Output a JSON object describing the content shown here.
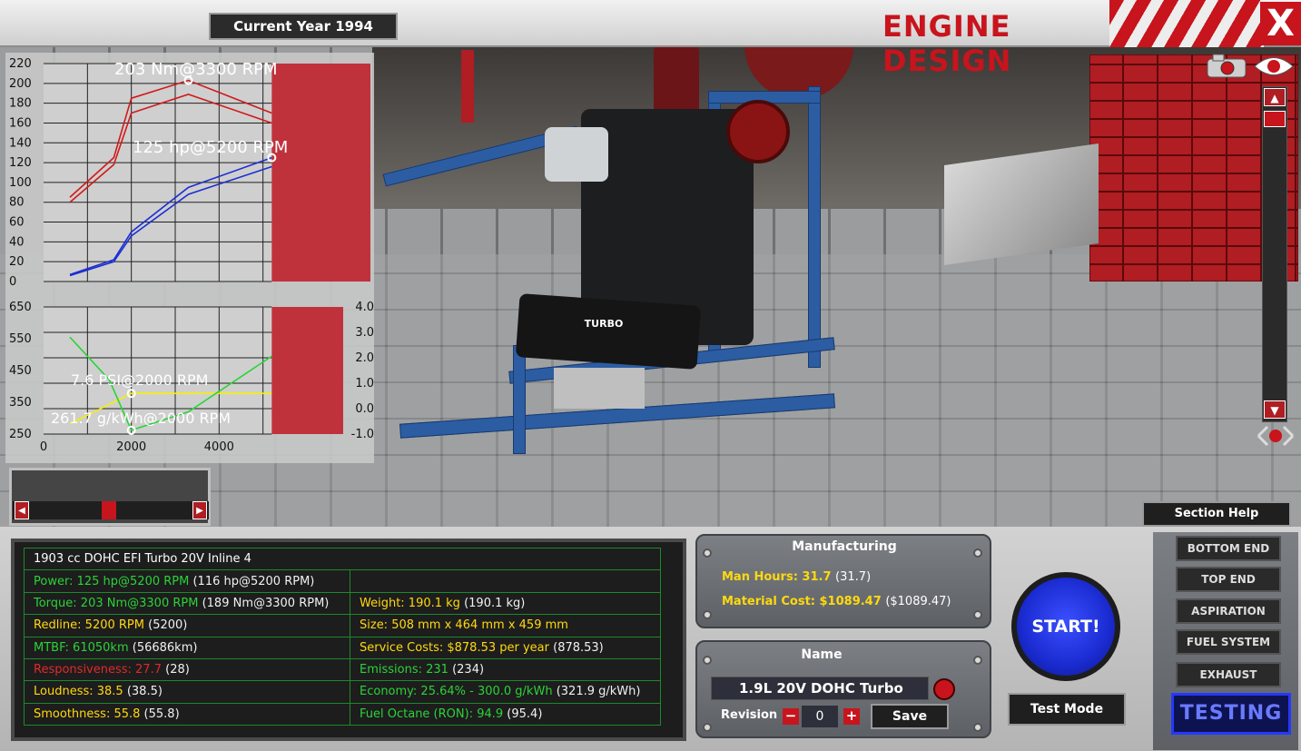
{
  "header": {
    "current_year_label": "Current Year 1994",
    "title": "ENGINE DESIGN",
    "close_label": "X"
  },
  "colors": {
    "accent_red": "#c8141c",
    "torque_line": "#d11a1a",
    "power_line": "#1b2fd1",
    "boost_line": "#f5f000",
    "economy_line": "#2bd338",
    "stat_green": "#2bd338",
    "stat_yellow": "#ffd90f",
    "stat_red": "#e02a2a"
  },
  "chart_data": [
    {
      "type": "line",
      "annotations": [
        "203 Nm@3300 RPM",
        "125 hp@5200 RPM"
      ],
      "y_ticks": [
        "220",
        "200",
        "180",
        "160",
        "140",
        "120",
        "100",
        "80",
        "60",
        "40",
        "20",
        "0"
      ],
      "ylim": [
        0,
        220
      ],
      "xlim": [
        0,
        6000
      ],
      "redline_shaded_from": 5200,
      "grid": true,
      "series": [
        {
          "key": "torque",
          "color": "#d11a1a",
          "x": [
            600,
            1600,
            2000,
            3300,
            5200
          ],
          "values": [
            85,
            125,
            185,
            203,
            170
          ]
        },
        {
          "key": "torque_alt",
          "color": "#d11a1a",
          "x": [
            600,
            1600,
            2000,
            3300,
            5200
          ],
          "values": [
            80,
            118,
            170,
            189,
            160
          ]
        },
        {
          "key": "power",
          "color": "#1b2fd1",
          "x": [
            600,
            1600,
            2000,
            3300,
            5200
          ],
          "values": [
            7,
            22,
            50,
            95,
            125
          ]
        },
        {
          "key": "power_alt",
          "color": "#1b2fd1",
          "x": [
            600,
            1600,
            2000,
            3300,
            5200
          ],
          "values": [
            6,
            20,
            46,
            88,
            116
          ]
        }
      ]
    },
    {
      "type": "line",
      "annotations": [
        "7.6 PSI@2000 RPM",
        "261.7 g/kWh@2000 RPM"
      ],
      "y_ticks_left": [
        "650",
        "550",
        "450",
        "350",
        "250"
      ],
      "y_ticks_right": [
        "4.0",
        "3.0",
        "2.0",
        "1.0",
        "0.0",
        "-1.0"
      ],
      "x_ticks": [
        "0",
        "2000",
        "4000"
      ],
      "ylim_left": [
        250,
        650
      ],
      "ylim_right": [
        -1.0,
        4.0
      ],
      "xlim": [
        0,
        6000
      ],
      "redline_shaded_from": 5200,
      "grid": true,
      "series": [
        {
          "key": "boost",
          "color": "#f5f000",
          "x": [
            600,
            2000,
            5200
          ],
          "values": [
            -0.6,
            0.6,
            0.6
          ]
        },
        {
          "key": "economy",
          "color": "#2bd338",
          "x": [
            600,
            1500,
            2000,
            3300,
            5200
          ],
          "values": [
            555,
            420,
            262,
            320,
            495
          ]
        }
      ]
    }
  ],
  "stats": {
    "description": "1903 cc DOHC EFI Turbo 20V Inline 4",
    "left": [
      {
        "label": "Power: 125 hp@5200 RPM",
        "extra": "(116 hp@5200 RPM)",
        "tone": "g"
      },
      {
        "label": "Torque: 203 Nm@3300 RPM",
        "extra": "(189 Nm@3300 RPM)",
        "tone": "g"
      },
      {
        "label": "Redline: 5200 RPM",
        "extra": "(5200)",
        "tone": "y"
      },
      {
        "label": "MTBF: 61050km",
        "extra": "(56686km)",
        "tone": "g"
      },
      {
        "label": "Responsiveness: 27.7",
        "extra": "(28)",
        "tone": "r"
      },
      {
        "label": "Loudness: 38.5",
        "extra": "(38.5)",
        "tone": "y"
      },
      {
        "label": "Smoothness: 55.8",
        "extra": "(55.8)",
        "tone": "y"
      }
    ],
    "right": [
      {
        "label": "Weight: 190.1 kg",
        "extra": "(190.1 kg)",
        "tone": "y"
      },
      {
        "label": "Size: 508 mm x 464 mm x 459 mm",
        "extra": "",
        "tone": "y"
      },
      {
        "label": "Service Costs: $878.53 per year",
        "extra": "(878.53)",
        "tone": "y"
      },
      {
        "label": "Emissions: 231",
        "extra": "(234)",
        "tone": "g"
      },
      {
        "label": "Economy: 25.64% - 300.0 g/kWh",
        "extra": "(321.9 g/kWh)",
        "tone": "g"
      },
      {
        "label": "Fuel Octane (RON): 94.9",
        "extra": "(95.4)",
        "tone": "g"
      }
    ]
  },
  "manufacturing": {
    "title": "Manufacturing",
    "man_hours_label": "Man Hours: 31.7",
    "man_hours_extra": "(31.7)",
    "material_cost_label": "Material Cost: $1089.47",
    "material_cost_extra": "($1089.47)"
  },
  "name_panel": {
    "title": "Name",
    "engine_name": "1.9L 20V DOHC Turbo",
    "revision_label": "Revision",
    "revision_value": "0",
    "save_label": "Save"
  },
  "controls": {
    "start_label": "START!",
    "test_mode_label": "Test Mode",
    "section_help_label": "Section Help",
    "testing_label": "TESTING"
  },
  "menu": [
    "BOTTOM END",
    "TOP END",
    "ASPIRATION",
    "FUEL SYSTEM",
    "EXHAUST"
  ],
  "icons": [
    "camera-icon",
    "eye-icon",
    "scroll-up-icon",
    "scroll-down-icon",
    "reset-view-icon",
    "refresh-icon"
  ],
  "engine_badge": "TURBO"
}
